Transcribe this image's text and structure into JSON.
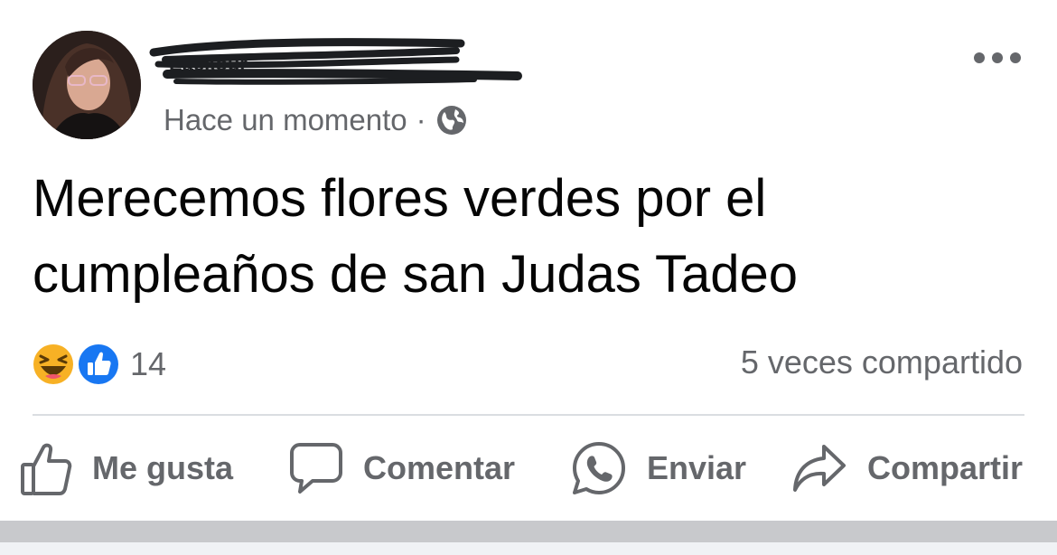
{
  "post": {
    "author": {
      "name": "Eackour",
      "name_redacted": true,
      "avatar_icon": "profile-photo"
    },
    "timestamp": "Hace un momento",
    "separator": "·",
    "audience_icon": "globe-icon",
    "options_icon": "more-horizontal-icon",
    "text": "Merecemos flores verdes por el cumpleaños de san Judas Tadeo",
    "reactions": {
      "icons": [
        "haha-emoji-icon",
        "like-reaction-icon"
      ],
      "count": "14"
    },
    "shares": "5 veces compartido"
  },
  "actions": [
    {
      "label": "Me gusta",
      "icon": "thumbs-up-icon"
    },
    {
      "label": "Comentar",
      "icon": "comment-bubble-icon"
    },
    {
      "label": "Enviar",
      "icon": "whatsapp-icon"
    },
    {
      "label": "Compartir",
      "icon": "share-arrow-icon"
    }
  ],
  "colors": {
    "text": "#050505",
    "secondary": "#65676b",
    "like_blue": "#1877f2",
    "haha_yellow": "#f7b125",
    "divider": "#dadde1"
  }
}
